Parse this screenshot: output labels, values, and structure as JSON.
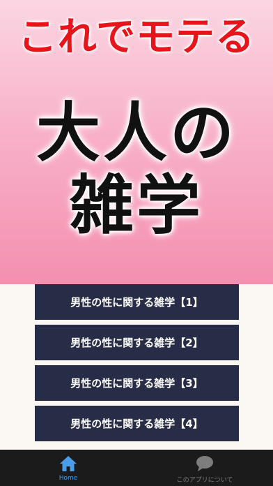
{
  "hero": {
    "tagline": "これでモテる",
    "title_line1": "大人の",
    "title_line2": "雑学"
  },
  "menu": {
    "items": [
      {
        "label": "男性の性に関する雑学【1】"
      },
      {
        "label": "男性の性に関する雑学【2】"
      },
      {
        "label": "男性の性に関する雑学【3】"
      },
      {
        "label": "男性の性に関する雑学【4】"
      }
    ]
  },
  "tabbar": {
    "home_label": "Home",
    "about_label": "このアプリについて",
    "home_icon": "home-icon",
    "about_icon": "speech-bubble-icon",
    "active_color": "#4a9de8",
    "inactive_color": "#7d7d7d"
  },
  "colors": {
    "menu_bg": "#282d47",
    "tagline": "#e8141c",
    "hero_bottom": "#f48fb0"
  }
}
